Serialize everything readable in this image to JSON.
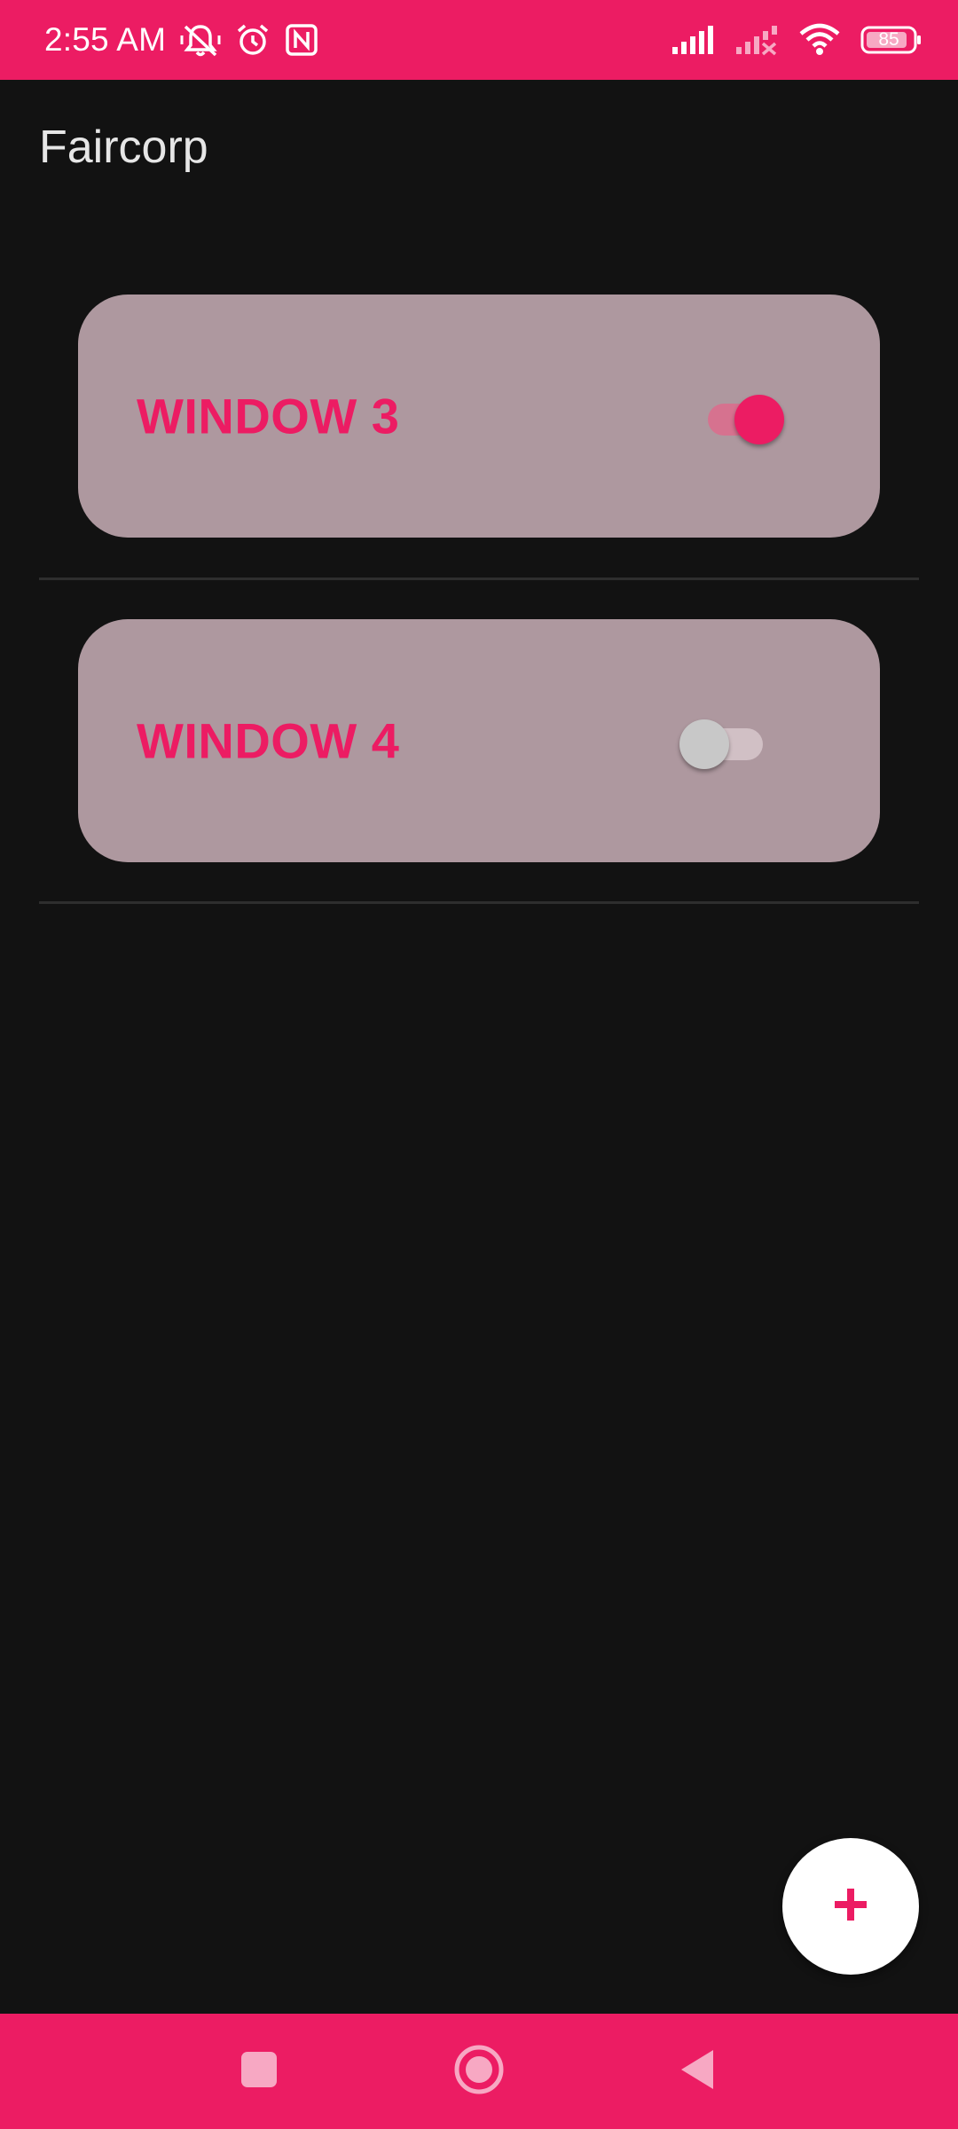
{
  "status_bar": {
    "time": "2:55 AM",
    "battery_level": "85",
    "icons": [
      "muted-notification-icon",
      "alarm-icon",
      "nfc-icon",
      "signal-icon",
      "signal-no-service-icon",
      "wifi-icon",
      "battery-icon"
    ]
  },
  "app": {
    "title": "Faircorp"
  },
  "windows": [
    {
      "label": "WINDOW 3",
      "switch_on": true
    },
    {
      "label": "WINDOW 4",
      "switch_on": false
    }
  ],
  "fab": {
    "icon": "plus-icon"
  },
  "nav_bar": {
    "icons": [
      "recents-icon",
      "home-icon",
      "back-icon"
    ]
  },
  "colors": {
    "accent": "#EC1C63",
    "background": "#121212",
    "card": "#AE989F"
  }
}
